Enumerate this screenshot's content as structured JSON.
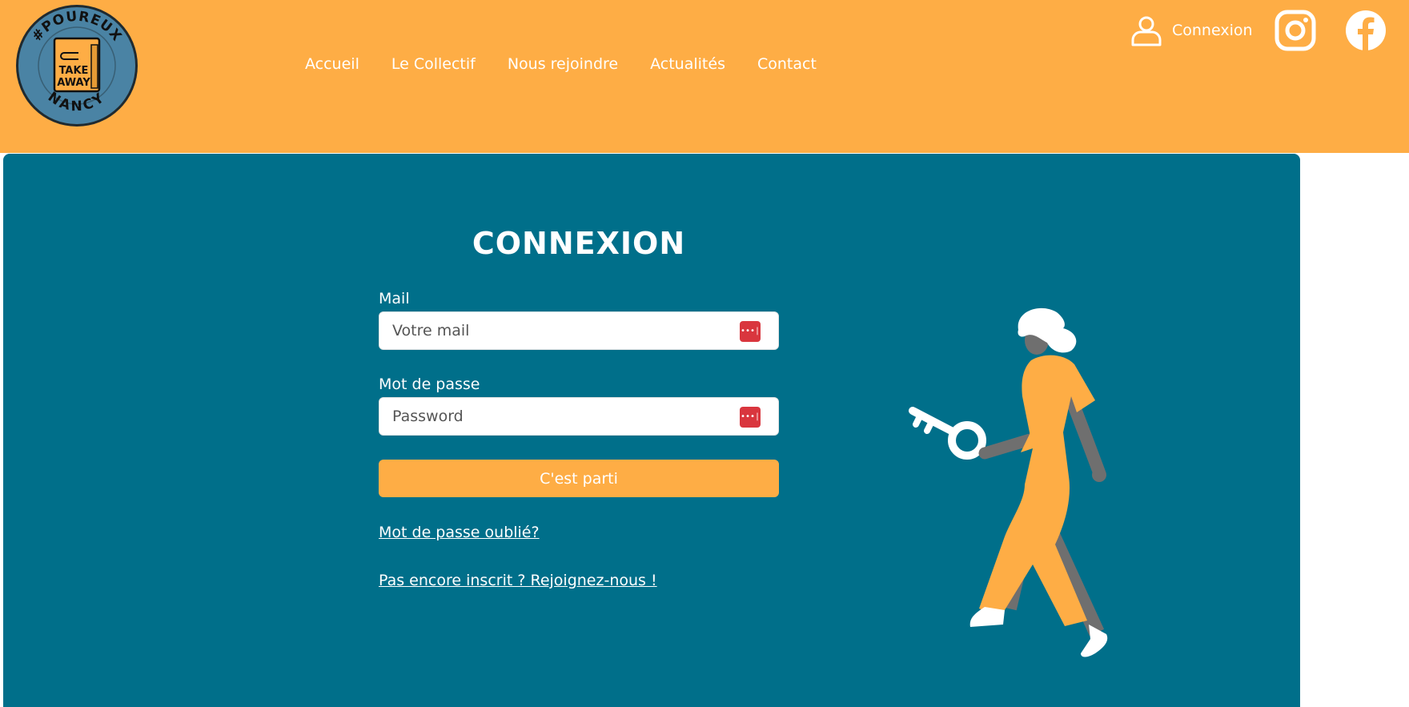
{
  "header": {
    "logo_text": {
      "ring_top": "#POUREUX",
      "ring_bottom": "NANCY",
      "center_line1": "TAKE",
      "center_line2": "AWAY"
    },
    "nav": [
      {
        "label": "Accueil"
      },
      {
        "label": "Le Collectif"
      },
      {
        "label": "Nous rejoindre"
      },
      {
        "label": "Actualités"
      },
      {
        "label": "Contact"
      }
    ],
    "login_label": "Connexion",
    "social": [
      {
        "icon": "instagram-icon"
      },
      {
        "icon": "facebook-icon"
      }
    ]
  },
  "form": {
    "title": "CONNEXION",
    "mail_label": "Mail",
    "mail_placeholder": "Votre mail",
    "password_label": "Mot de passe",
    "password_placeholder": "Password",
    "submit_label": "C'est parti",
    "forgot_link": "Mot de passe oublié?",
    "register_link": "Pas encore inscrit ? Rejoignez-nous !"
  },
  "colors": {
    "accent": "#FEAD45",
    "panel": "#006F8A",
    "password_manager": "#D9363E"
  }
}
